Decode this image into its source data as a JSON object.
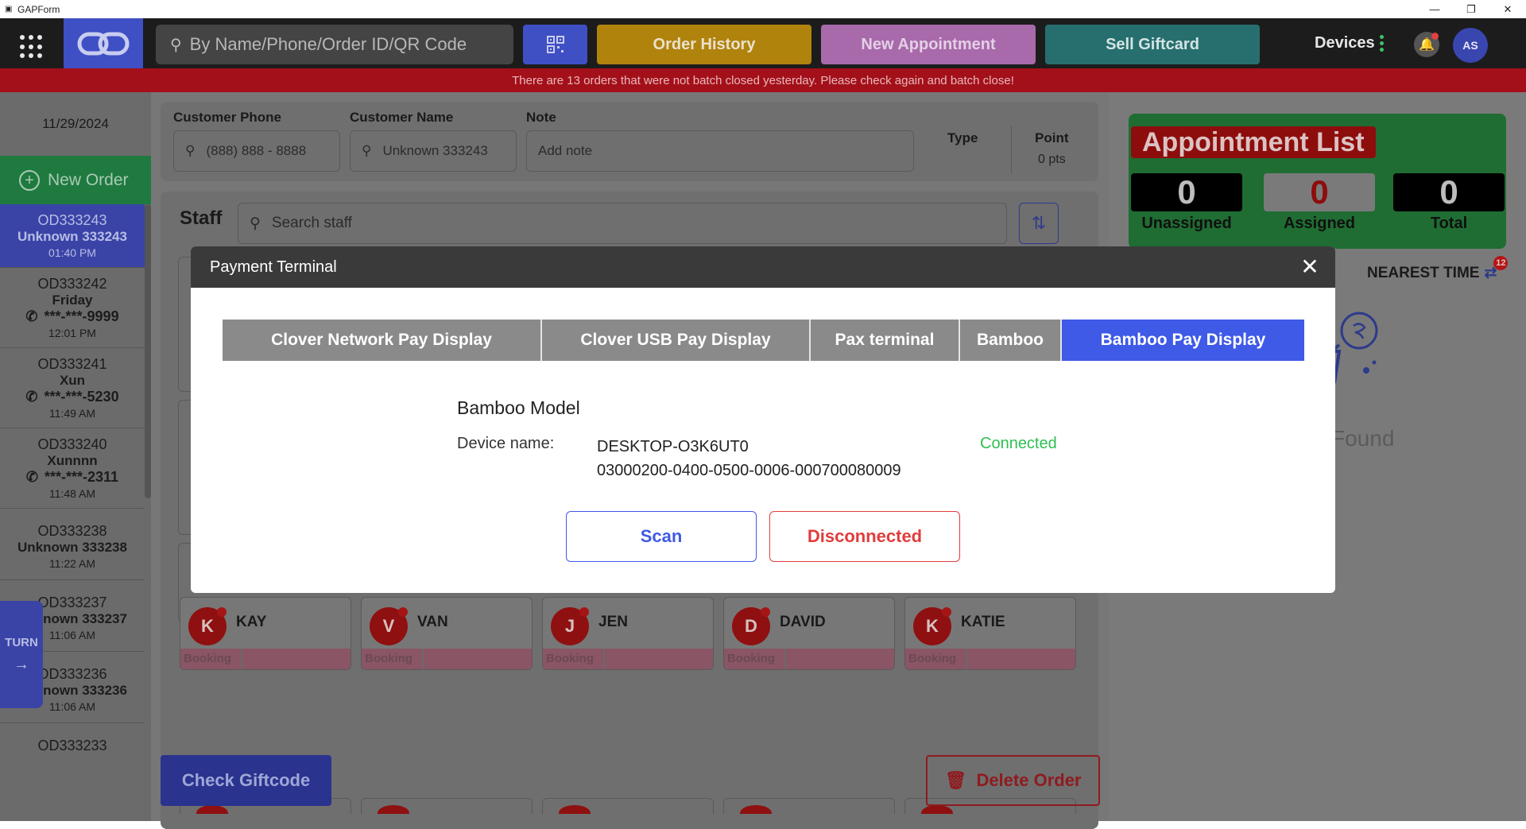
{
  "window": {
    "title": "GAPForm"
  },
  "header": {
    "search_placeholder": "By Name/Phone/Order ID/QR Code",
    "order_history": "Order History",
    "new_appointment": "New Appointment",
    "sell_giftcard": "Sell Giftcard",
    "devices": "Devices",
    "avatar": "AS"
  },
  "banner": "There are 13 orders that were not batch closed yesterday. Please check again and batch close!",
  "sidebar": {
    "date": "11/29/2024",
    "new_order": "New Order",
    "turn": "TURN",
    "orders": [
      {
        "id": "OD333243",
        "name": "Unknown 333243",
        "phone": "",
        "time": "01:40 PM"
      },
      {
        "id": "OD333242",
        "name": "Friday",
        "phone": "***-***-9999",
        "time": "12:01 PM"
      },
      {
        "id": "OD333241",
        "name": "Xun",
        "phone": "***-***-5230",
        "time": "11:49 AM"
      },
      {
        "id": "OD333240",
        "name": "Xunnnn",
        "phone": "***-***-2311",
        "time": "11:48 AM"
      },
      {
        "id": "OD333238",
        "name": "Unknown 333238",
        "phone": "",
        "time": "11:22 AM"
      },
      {
        "id": "OD333237",
        "name": "Unknown 333237",
        "phone": "",
        "time": "11:06 AM"
      },
      {
        "id": "OD333236",
        "name": "Unknown 333236",
        "phone": "",
        "time": "11:06 AM"
      },
      {
        "id": "OD333233",
        "name": "",
        "phone": "",
        "time": ""
      }
    ]
  },
  "customer": {
    "phone_label": "Customer Phone",
    "phone_placeholder": "(888) 888 - 8888",
    "name_label": "Customer Name",
    "name_value": "Unknown 333243",
    "note_label": "Note",
    "note_placeholder": "Add note",
    "type_label": "Type",
    "point_label": "Point",
    "point_value": "0 pts"
  },
  "staff": {
    "title": "Staff",
    "search_placeholder": "Search staff",
    "booking_label": "Booking",
    "members": [
      {
        "initial": "K",
        "name": "KAY"
      },
      {
        "initial": "V",
        "name": "VAN"
      },
      {
        "initial": "J",
        "name": "JEN"
      },
      {
        "initial": "D",
        "name": "DAVID"
      },
      {
        "initial": "K",
        "name": "KATIE"
      }
    ]
  },
  "actions": {
    "check_giftcode": "Check Giftcode",
    "delete_order": "Delete Order"
  },
  "appointments": {
    "title": "Appointment List",
    "unassigned_count": "0",
    "unassigned_label": "Unassigned",
    "assigned_count": "0",
    "assigned_label": "Assigned",
    "total_count": "0",
    "total_label": "Total",
    "nearest_time": "NEAREST TIME",
    "nearest_badge": "12",
    "empty_text": "Found"
  },
  "modal": {
    "title": "Payment Terminal",
    "tabs": [
      "Clover Network Pay Display",
      "Clover USB Pay Display",
      "Pax terminal",
      "Bamboo",
      "Bamboo Pay Display"
    ],
    "active_tab": "Bamboo Pay Display",
    "model_title": "Bamboo Model",
    "device_label": "Device name:",
    "device_name": "DESKTOP-O3K6UT0",
    "device_id": "03000200-0400-0500-0006-000700080009",
    "status": "Connected",
    "scan": "Scan",
    "disconnect": "Disconnected"
  },
  "colors": {
    "accent": "#3f5ae6",
    "connected": "#2fbf52",
    "danger": "#e23c3c",
    "banner": "#a3101a",
    "appointment_panel": "#1f6d32"
  }
}
